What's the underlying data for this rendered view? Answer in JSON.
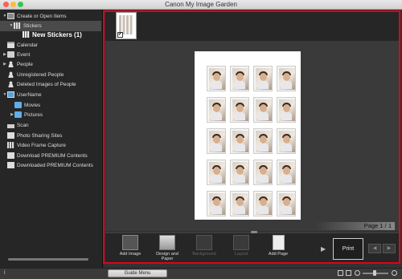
{
  "window": {
    "title": "Canon My Image Garden"
  },
  "sidebar": {
    "items": [
      {
        "label": "Create or Open Items"
      },
      {
        "label": "Stickers"
      },
      {
        "label": "New Stickers (1)"
      },
      {
        "label": "Calendar"
      },
      {
        "label": "Event"
      },
      {
        "label": "People"
      },
      {
        "label": "Unregistered People"
      },
      {
        "label": "Deleted Images of People"
      },
      {
        "label": "UserName"
      },
      {
        "label": "Movies"
      },
      {
        "label": "Pictures"
      },
      {
        "label": "Scan"
      },
      {
        "label": "Photo Sharing Sites"
      },
      {
        "label": "Video Frame Capture"
      },
      {
        "label": "Download PREMIUM Contents"
      },
      {
        "label": "Downloaded PREMIUM Contents"
      }
    ]
  },
  "preview": {
    "page_label": "Page 1 / 1"
  },
  "toolbar": {
    "add_image": "Add Image",
    "design_and_paper": "Design and Paper",
    "background": "Background",
    "layout": "Layout",
    "add_page": "Add Page",
    "print": "Print"
  },
  "footer": {
    "guide_menu": "Guide Menu"
  },
  "colors": {
    "highlight_frame": "#e0001a"
  }
}
